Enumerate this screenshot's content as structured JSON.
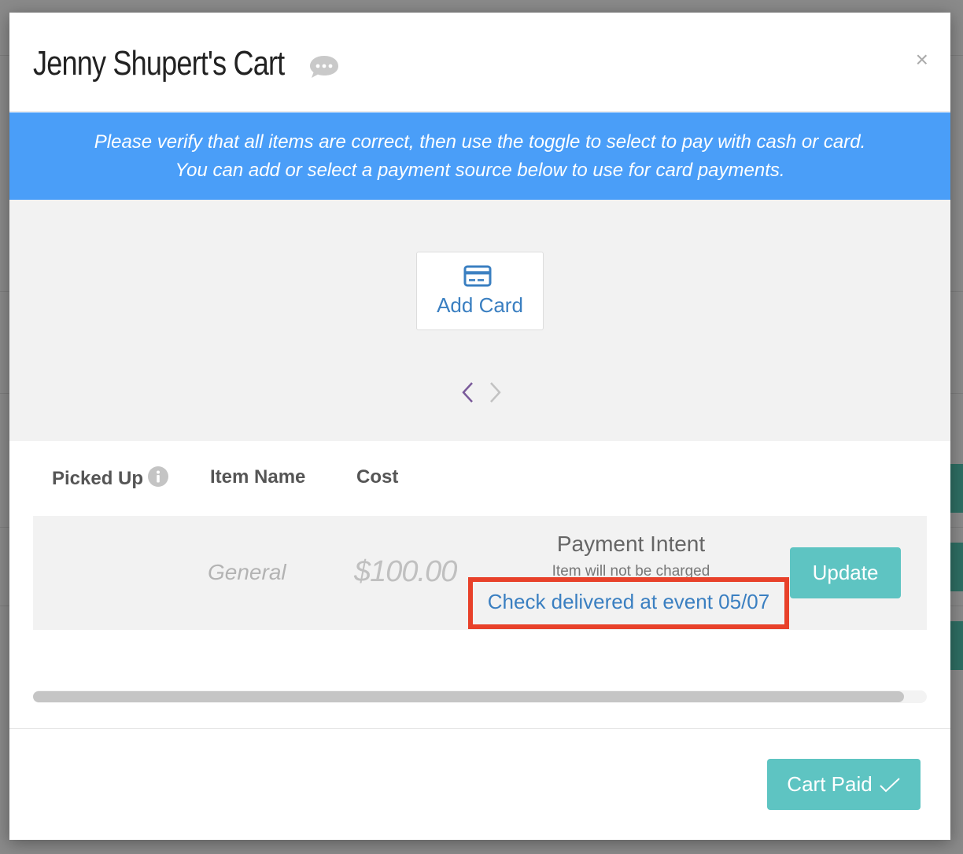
{
  "modal": {
    "title": "Jenny Shupert's Cart",
    "close_glyph": "×",
    "banner_line1": "Please verify that all items are correct, then use the toggle to select to pay with cash or card.",
    "banner_line2": "You can add or select a payment source below to use for card payments."
  },
  "payment": {
    "add_card_label": "Add Card",
    "icon": "credit-card-icon"
  },
  "table": {
    "headers": [
      "Picked Up",
      "Item Name",
      "Cost"
    ],
    "rows": [
      {
        "item_name": "General",
        "cost": "$100.00",
        "payment_intent_title": "Payment Intent",
        "payment_intent_note": "Item will not be charged",
        "payment_intent_link": "Check delivered at event 05/07",
        "update_label": "Update"
      }
    ]
  },
  "footer": {
    "cart_paid_label": "Cart Paid"
  },
  "colors": {
    "banner": "#4a9ef8",
    "accent_teal": "#5ec4c2",
    "link_blue": "#3a7fc1",
    "highlight_red": "#e8412a"
  }
}
